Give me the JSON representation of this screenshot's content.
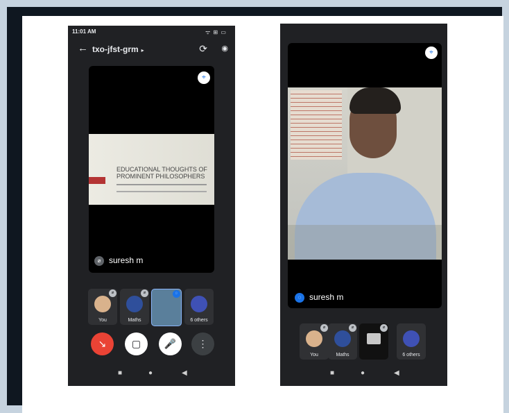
{
  "left_phone": {
    "status": {
      "time": "11:01 AM",
      "icons": "ᯤ ⊞ ▭"
    },
    "app_bar": {
      "meeting_code": "txo-jfst-grm",
      "dropdown": "▸",
      "back": "←",
      "flip": "⟳",
      "speaker": "◉"
    },
    "main_tile": {
      "slide_title": "EDUCATIONAL THOUGHTS OF PROMINENT PHILOSOPHERS",
      "name": "suresh m"
    },
    "tiles": [
      {
        "label": "You",
        "avatar_color": "#d9b28c"
      },
      {
        "label": "Maths",
        "avatar_color": "#2f4f9b"
      },
      {
        "label": "",
        "avatar_color": "#5a7f9b"
      },
      {
        "label": "6 others",
        "avatar_color": "#3f51b5"
      }
    ],
    "controls": {
      "end_call": "↘",
      "camera": "▢",
      "mic": "🎤",
      "more": "⋮"
    }
  },
  "right_phone": {
    "main_tile": {
      "name": "suresh m"
    },
    "tiles": [
      {
        "label": "You",
        "avatar_color": "#d9b28c"
      },
      {
        "label": "Maths",
        "avatar_color": "#2f4f9b"
      },
      {
        "label": "",
        "avatar_color": "#111"
      },
      {
        "label": "6 others",
        "avatar_color": "#3f51b5"
      }
    ]
  },
  "nav": {
    "square": "■",
    "home": "●",
    "back": "◀"
  },
  "colors": {
    "end_call": "#ea4335",
    "background": "#c6d3df",
    "frame": "#0f1720"
  }
}
